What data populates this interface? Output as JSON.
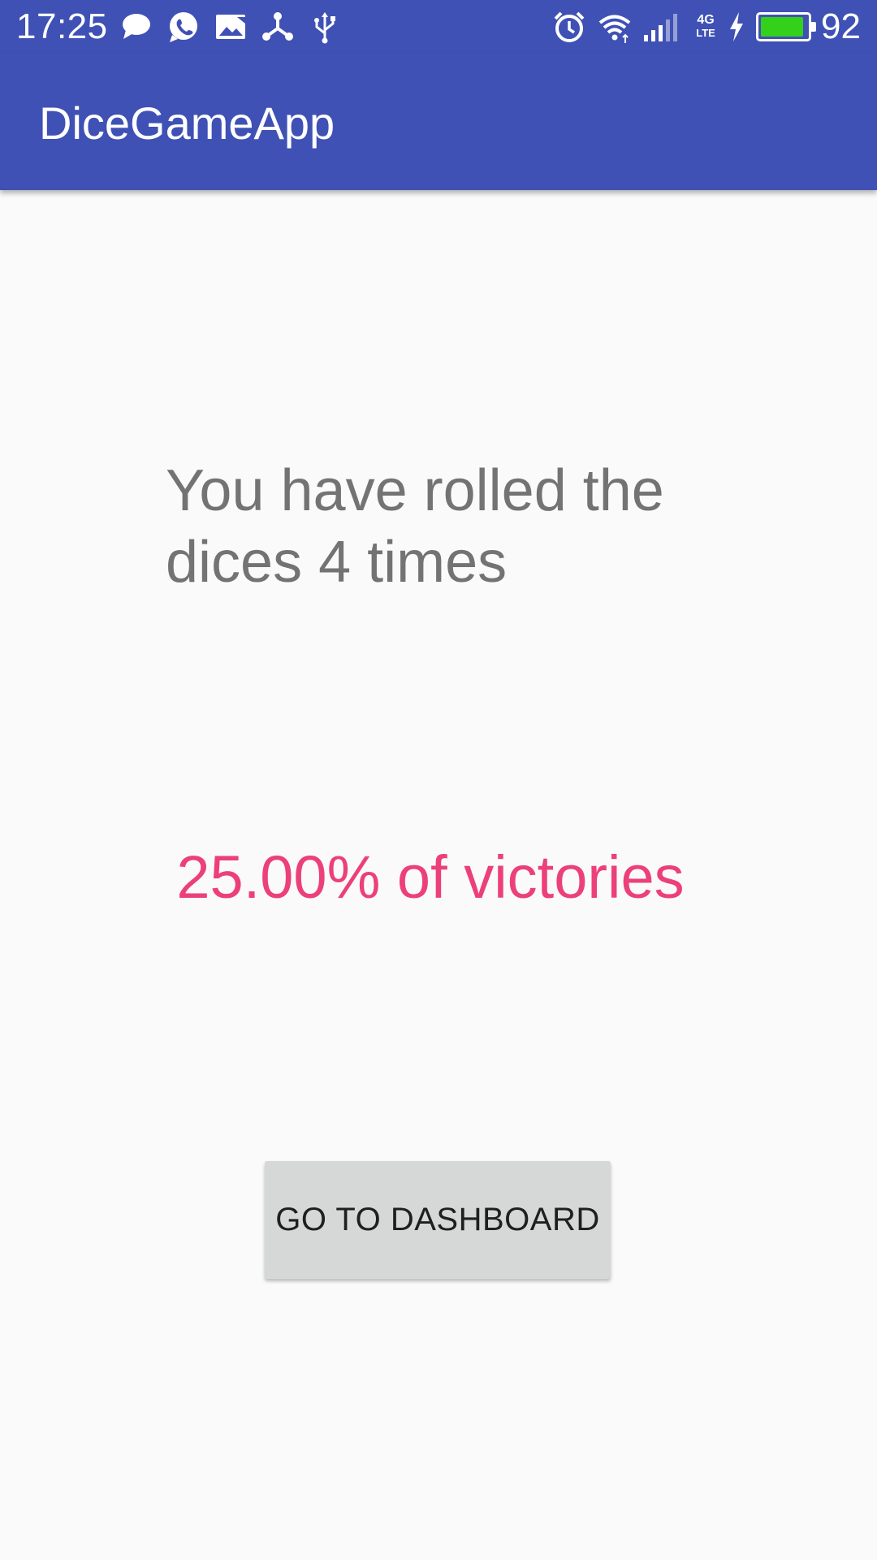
{
  "status_bar": {
    "time": "17:25",
    "notification_icons": [
      "chat-bubble-icon",
      "whatsapp-icon",
      "image-icon",
      "share-icon",
      "usb-icon"
    ],
    "system_icons": [
      "alarm-icon",
      "wifi-icon",
      "signal-icon",
      "4g-lte-icon",
      "charging-icon"
    ],
    "network_label_top": "4G",
    "network_label_bottom": "LTE",
    "battery_level": 92,
    "battery_percent": "92"
  },
  "app_bar": {
    "title": "DiceGameApp"
  },
  "main": {
    "rolled_text": "You have rolled the dices 4 times",
    "victory_text": "25.00% of victories",
    "dashboard_button_label": "GO TO DASHBOARD"
  },
  "colors": {
    "primary": "#3f51b5",
    "accent": "#ec407a",
    "background": "#fafafa",
    "body_text": "#737373",
    "button_bg": "#d6d7d7",
    "battery_fill": "#33d11a"
  }
}
